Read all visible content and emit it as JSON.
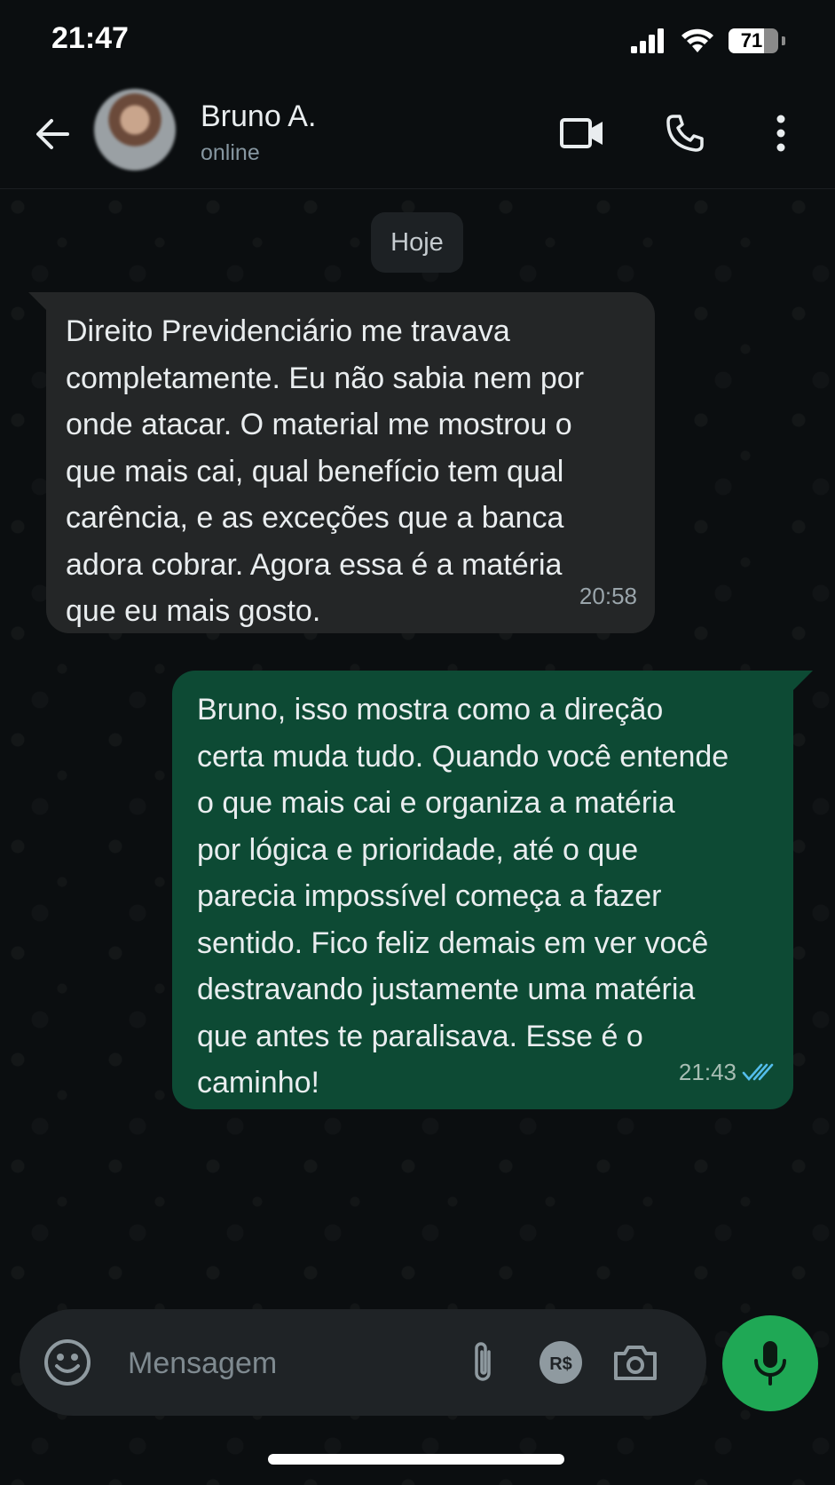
{
  "status_bar": {
    "time": "21:47",
    "battery": "71",
    "battery_level": 0.71
  },
  "header": {
    "contact_name": "Bruno A.",
    "contact_status": "online"
  },
  "chat": {
    "date_chip": "Hoje",
    "messages": [
      {
        "direction": "incoming",
        "text": "Direito Previdenciário me travava\ncompletamente. Eu não sabia nem por\nonde atacar. O material me mostrou o\nque mais cai, qual benefício tem qual\ncarência, e as exceções que a banca\nadora cobrar. Agora essa é a matéria\nque eu mais gosto.",
        "time": "20:58"
      },
      {
        "direction": "outgoing",
        "text": "Bruno, isso mostra como a direção\ncerta muda tudo. Quando você entende\no que mais cai e organiza a matéria\npor lógica e prioridade, até o que\nparecia impossível começa a fazer\nsentido. Fico feliz demais em ver você\ndestravando justamente uma matéria\nque antes te paralisava. Esse é o\ncaminho!",
        "time": "21:43",
        "read_receipt": "double-check-icon",
        "receipt_color": "#53bdeb"
      }
    ]
  },
  "composer": {
    "placeholder": "Mensagem",
    "value": ""
  },
  "colors": {
    "accent": "#1fa855",
    "outgoing_bubble": "#0d4a34",
    "incoming_bubble": "#242627"
  }
}
